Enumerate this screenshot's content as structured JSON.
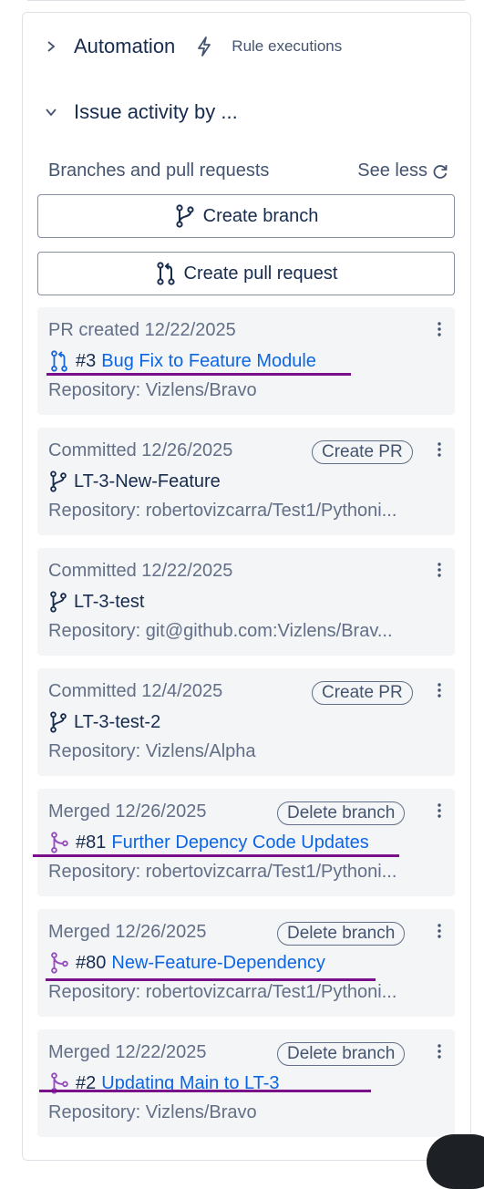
{
  "automation": {
    "title": "Automation",
    "rule_link": "Rule executions"
  },
  "issue_activity": {
    "title": "Issue activity by ..."
  },
  "dev": {
    "header": "Branches and pull requests",
    "see_less": "See less",
    "create_branch": "Create branch",
    "create_pr": "Create pull request"
  },
  "cards": [
    {
      "status": "PR created 12/22/2025",
      "number": "#3",
      "title": "Bug Fix to Feature Module",
      "repo": "Repository: Vizlens/Bravo",
      "icon": "pull-request-icon",
      "icon_color": "#1868db"
    },
    {
      "status": "Committed 12/26/2025",
      "action": "Create PR",
      "title": "LT-3-New-Feature",
      "repo": "Repository: robertovizcarra/Test1/Pythoni...",
      "icon": "branch-icon"
    },
    {
      "status": "Committed 12/22/2025",
      "title": "LT-3-test",
      "repo": "Repository: git@github.com:Vizlens/Brav...",
      "icon": "branch-icon"
    },
    {
      "status": "Committed 12/4/2025",
      "action": "Create PR",
      "title": "LT-3-test-2",
      "repo": "Repository: Vizlens/Alpha",
      "icon": "branch-icon"
    },
    {
      "status": "Merged 12/26/2025",
      "action": "Delete branch",
      "number": "#81",
      "title": "Further Depency Code Updates",
      "repo": "Repository: robertovizcarra/Test1/Pythoni...",
      "icon": "merged-icon",
      "icon_color": "#964ac0"
    },
    {
      "status": "Merged 12/26/2025",
      "action": "Delete branch",
      "number": "#80",
      "title": "New-Feature-Dependency",
      "repo": "Repository: robertovizcarra/Test1/Pythoni...",
      "icon": "merged-icon",
      "icon_color": "#964ac0"
    },
    {
      "status": "Merged 12/22/2025",
      "action": "Delete branch",
      "number": "#2",
      "title": "Updating Main to LT-3",
      "repo": "Repository: Vizlens/Bravo",
      "icon": "merged-icon",
      "icon_color": "#964ac0"
    }
  ],
  "colors": {
    "link": "#0c66e4",
    "underline": "#7a0f8a",
    "merged": "#964ac0",
    "pr": "#1868db"
  }
}
